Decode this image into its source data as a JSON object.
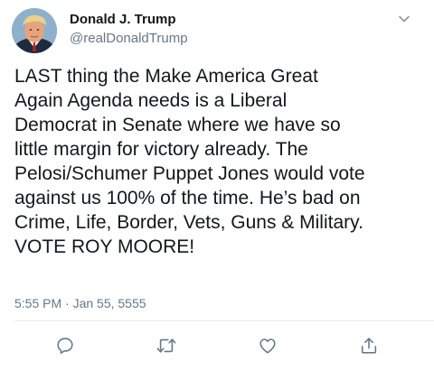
{
  "author": {
    "display_name": "Donald J. Trump",
    "handle": "@realDonaldTrump"
  },
  "tweet": {
    "lines": [
      "LAST thing the Make America Great",
      "Again Agenda needs is a Liberal",
      "Democrat in Senate where we have so",
      "little margin for victory already. The",
      "Pelosi/Schumer Puppet Jones would vote",
      "against us 100% of the time. He’s bad on",
      "Crime, Life, Border, Vets, Guns & Military.",
      "VOTE ROY MOORE!"
    ],
    "timestamp": "5:55 PM · Jan 55, 5555"
  },
  "icons": {
    "more": "chevron-down-icon",
    "reply": "reply-icon",
    "retweet": "retweet-icon",
    "like": "heart-icon",
    "share": "share-icon"
  },
  "colors": {
    "text": "#14171a",
    "secondary": "#657786",
    "divider": "#e6ecf0"
  }
}
